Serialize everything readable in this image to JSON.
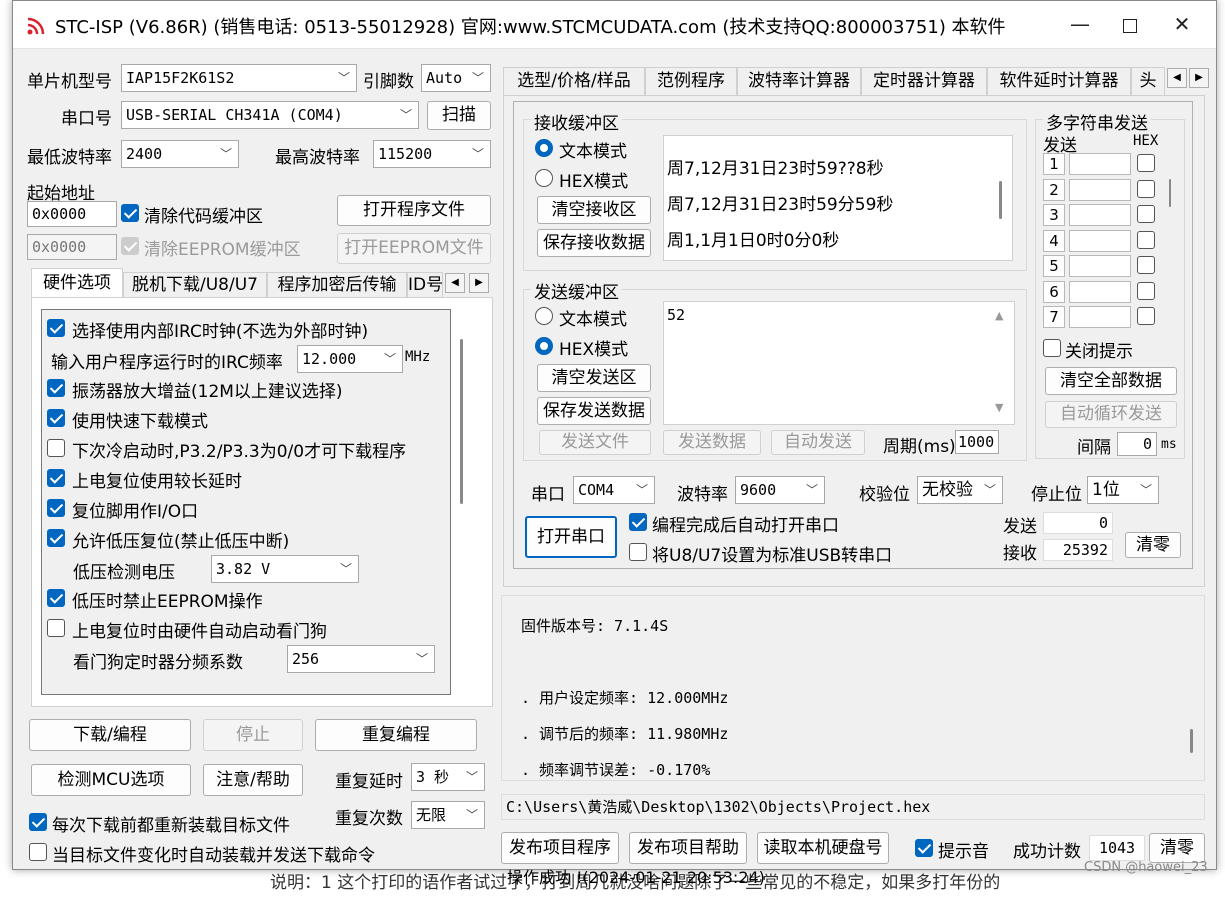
{
  "title": "STC-ISP (V6.86R) (销售电话: 0513-55012928) 官网:www.STCMCUDATA.com  (技术支持QQ:800003751) 本软件...",
  "left": {
    "mcu_label": "单片机型号",
    "mcu_value": "IAP15F2K61S2",
    "pins_label": "引脚数",
    "pins_value": "Auto",
    "port_label": "串口号",
    "port_value": "USB-SERIAL CH341A (COM4)",
    "scan_button": "扫描",
    "min_baud_label": "最低波特率",
    "min_baud_value": "2400",
    "max_baud_label": "最高波特率",
    "max_baud_value": "115200",
    "start_addr_label": "起始地址",
    "addr1": "0x0000",
    "clear_code_label": "清除代码缓冲区",
    "open_program_button": "打开程序文件",
    "addr2": "0x0000",
    "clear_eeprom_label": "清除EEPROM缓冲区",
    "open_eeprom_button": "打开EEPROM文件",
    "tabs": [
      "硬件选项",
      "脱机下载/U8/U7",
      "程序加密后传输",
      "ID号"
    ],
    "options": {
      "irc": "选择使用内部IRC时钟(不选为外部时钟)",
      "irc_freq_label": "输入用户程序运行时的IRC频率",
      "irc_freq_value": "12.000",
      "irc_unit": "MHz",
      "osc_gain": "振荡器放大增益(12M以上建议选择)",
      "fast_dl": "使用快速下载模式",
      "cold_boot": "下次冷启动时,P3.2/P3.3为0/0才可下载程序",
      "por_delay": "上电复位使用较长延时",
      "reset_io": "复位脚用作I/O口",
      "low_volt_reset": "允许低压复位(禁止低压中断)",
      "lvd_label": "低压检测电压",
      "lvd_value": "3.82 V",
      "lvd_eeprom": "低压时禁止EEPROM操作",
      "wdt_auto": "上电复位时由硬件自动启动看门狗",
      "wdt_div_label": "看门狗定时器分频系数",
      "wdt_div_value": "256"
    },
    "download_button": "下载/编程",
    "stop_button": "停止",
    "reprogram_button": "重复编程",
    "detect_button": "检测MCU选项",
    "help_button": "注意/帮助",
    "repeat_delay_label": "重复延时",
    "repeat_delay_value": "3 秒",
    "repeat_count_label": "重复次数",
    "repeat_count_value": "无限",
    "reload_label": "每次下载前都重新装载目标文件",
    "auto_load_label": "当目标文件变化时自动装载并发送下载命令"
  },
  "right": {
    "tabs": [
      "选型/价格/样品",
      "范例程序",
      "波特率计算器",
      "定时器计算器",
      "软件延时计算器",
      "头"
    ],
    "recv_group": "接收缓冲区",
    "recv_text_mode": "文本模式",
    "recv_hex_mode": "HEX模式",
    "clear_recv": "清空接收区",
    "save_recv": "保存接收数据",
    "recv_lines": [
      "周7,12月31日23时59??8秒",
      "周7,12月31日23时59分59秒",
      "周1,1月1日0时0分0秒"
    ],
    "send_group": "发送缓冲区",
    "send_text_mode": "文本模式",
    "send_hex_mode": "HEX模式",
    "clear_send": "清空发送区",
    "save_send": "保存发送数据",
    "send_content": "52",
    "send_file": "发送文件",
    "send_data": "发送数据",
    "auto_send": "自动发送",
    "period_label": "周期(ms)",
    "period_value": "1000",
    "multi_group": "多字符串发送",
    "multi_send_col": "发送",
    "multi_hex_col": "HEX",
    "multi_rows": [
      "1",
      "2",
      "3",
      "4",
      "5",
      "6",
      "7"
    ],
    "close_hint": "关闭提示",
    "clear_all": "清空全部数据",
    "auto_loop": "自动循环发送",
    "interval_label": "间隔",
    "interval_value": "0",
    "interval_unit": "ms",
    "serial_label": "串口",
    "serial_value": "COM4",
    "baud_label": "波特率",
    "baud_value": "9600",
    "parity_label": "校验位",
    "parity_value": "无校验",
    "stop_label": "停止位",
    "stop_value": "1位",
    "open_serial": "打开串口",
    "auto_open": "编程完成后自动打开串口",
    "u8u7_std": "将U8/U7设置为标准USB转串口",
    "sent_label": "发送",
    "sent_value": "0",
    "recv_label": "接收",
    "recv_value": "25392",
    "clear_counts": "清零",
    "log_lines": [
      "固件版本号: 7.1.4S",
      "",
      ". 用户设定频率: 12.000MHz",
      ". 调节后的频率: 11.980MHz",
      ". 频率调节误差: -0.170%",
      "",
      "",
      "操作成功 !(2024-01-21 20:53:24)"
    ],
    "path": "C:\\Users\\黄浩威\\Desktop\\1302\\Objects\\Project.hex",
    "publish_program": "发布项目程序",
    "publish_help": "发布项目帮助",
    "read_disk": "读取本机硬盘号",
    "beep_label": "提示音",
    "success_label": "成功计数",
    "success_value": "1043",
    "clear_success": "清零"
  },
  "footer": {
    "below_text": "说明：1 这个打印的语作者试过了，打到周几就没啥问题除了一些常见的不稳定，如果多打年份的",
    "watermark": "CSDN @haowei_23"
  }
}
